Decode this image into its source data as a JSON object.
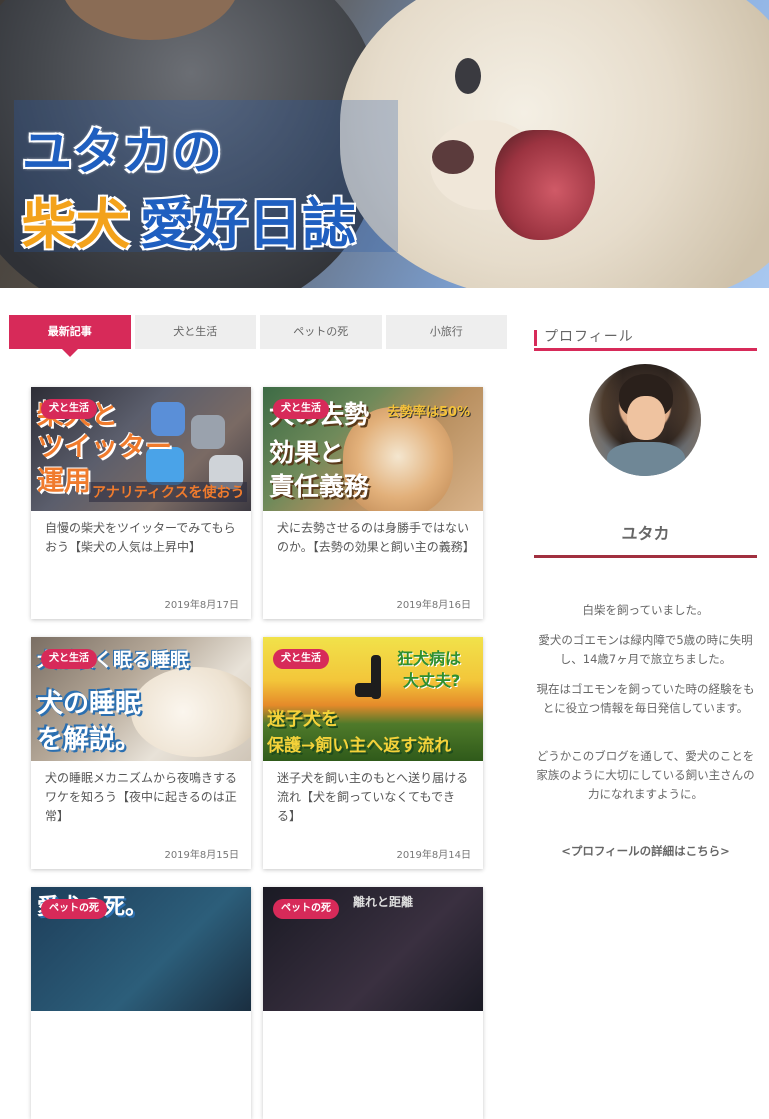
{
  "header": {
    "title_line1": "ユタカの",
    "title_line2_a": "柴犬",
    "title_line2_b": "愛好日誌"
  },
  "tabs": [
    {
      "label": "最新記事",
      "active": true
    },
    {
      "label": "犬と生活",
      "active": false
    },
    {
      "label": "ペットの死",
      "active": false
    },
    {
      "label": "小旅行",
      "active": false
    }
  ],
  "cards": [
    {
      "category": "犬と生活",
      "thumb_text": [
        "柴犬と",
        "ツイッター",
        "運用",
        "アナリティクスを使おう"
      ],
      "title": "自慢の柴犬をツイッターでみてもらおう【柴犬の人気は上昇中】",
      "date": "2019年8月17日"
    },
    {
      "category": "犬と生活",
      "thumb_text": [
        "犬の去勢",
        "去勢率は50%",
        "効果と",
        "責任義務"
      ],
      "title": "犬に去勢させるのは身勝手ではないのか。【去勢の効果と飼い主の義務】",
      "date": "2019年8月16日"
    },
    {
      "category": "犬と生活",
      "thumb_text": [
        "犬が長く眠る睡眠",
        "犬の睡眠",
        "を解説。"
      ],
      "title": "犬の睡眠メカニズムから夜鳴きするワケを知ろう【夜中に起きるのは正常】",
      "date": "2019年8月15日"
    },
    {
      "category": "犬と生活",
      "thumb_text": [
        "狂犬病は",
        "大丈夫?",
        "迷子犬を",
        "保護→飼い主へ返す流れ"
      ],
      "title": "迷子犬を飼い主のもとへ送り届ける流れ【犬を飼っていなくてもできる】",
      "date": "2019年8月14日"
    },
    {
      "category": "ペットの死",
      "thumb_text": [
        "愛犬の死。"
      ]
    },
    {
      "category": "ペットの死",
      "thumb_text": [
        "離れと距離"
      ]
    }
  ],
  "sidebar": {
    "heading": "プロフィール",
    "name": "ユタカ",
    "desc": [
      "白柴を飼っていました。",
      "愛犬のゴエモンは緑内障で5歳の時に失明し、14歳7ヶ月で旅立ちました。",
      "現在はゴエモンを飼っていた時の経験をもとに役立つ情報を毎日発信しています。",
      "どうかこのブログを通して、愛犬のことを家族のように大切にしている飼い主さんの力になれますように。"
    ],
    "link": "<プロフィールの詳細はこちら>"
  }
}
